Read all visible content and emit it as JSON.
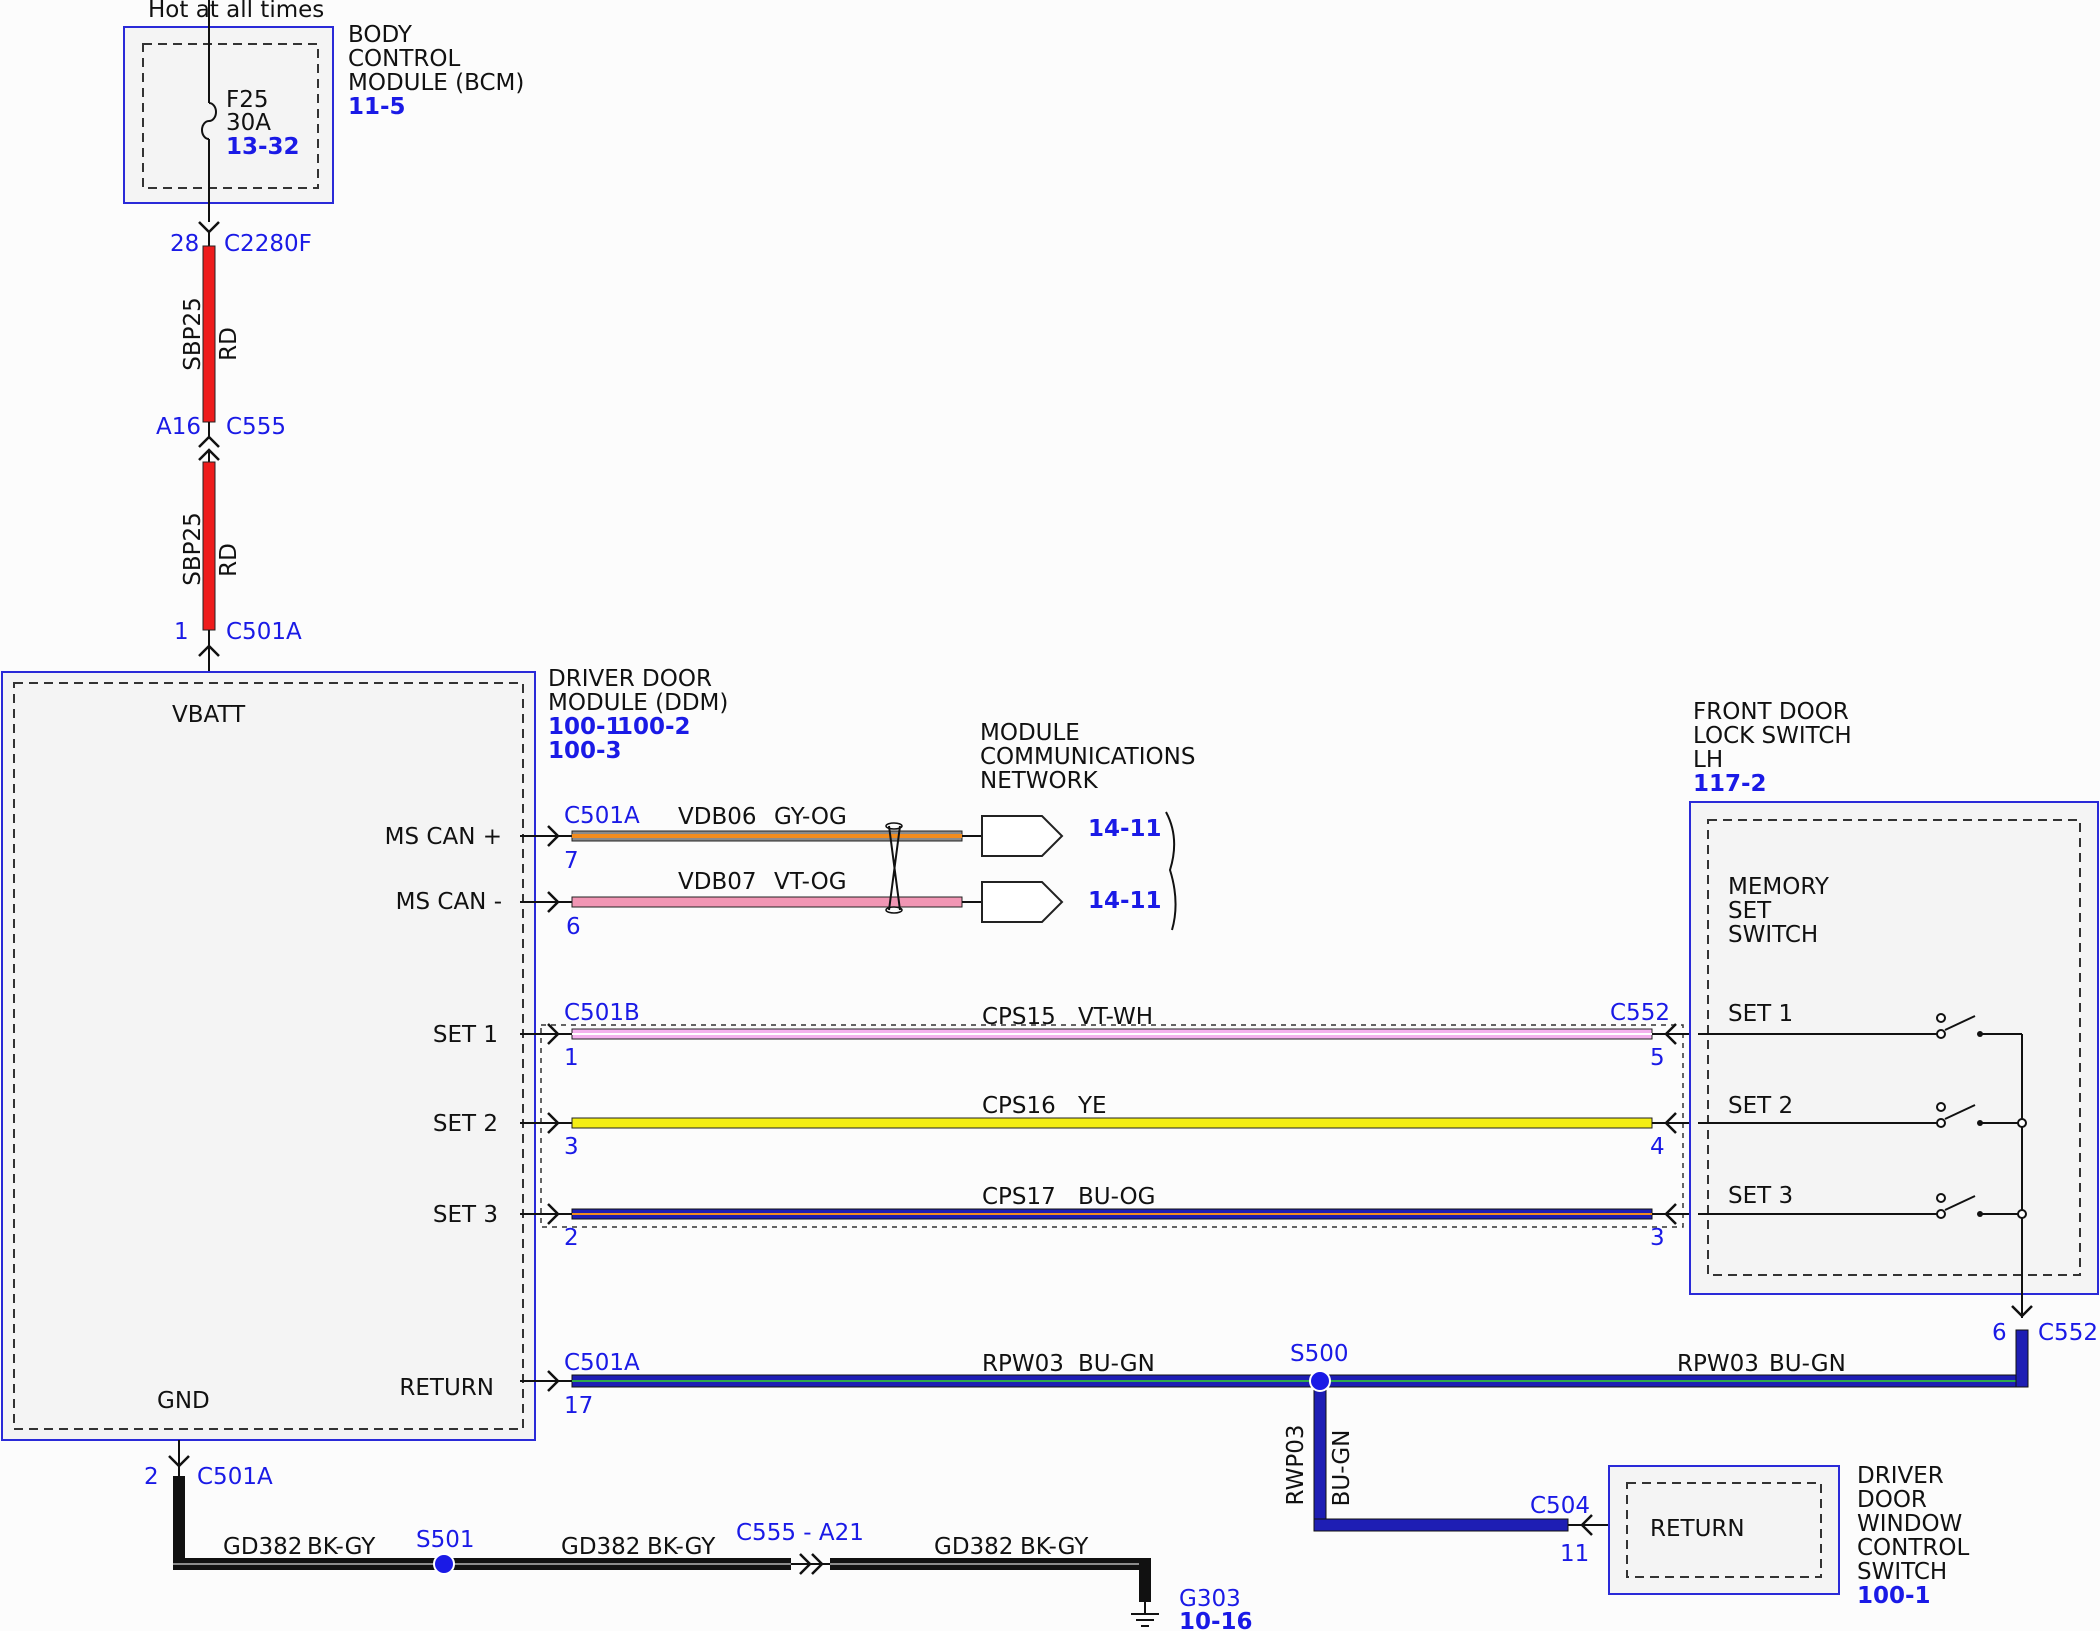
{
  "bcm": {
    "power_note": "Hot at all times",
    "title_lines": [
      "BODY",
      "CONTROL",
      "MODULE (BCM)"
    ],
    "ref": "11-5",
    "fuse_id": "F25",
    "fuse_rating": "30A",
    "fuse_ref": "13-32"
  },
  "feed_wire": {
    "top_pin": "28",
    "top_connector": "C2280F",
    "circuit": "SBP25",
    "color": "RD",
    "mid_pin": "A16",
    "mid_connector": "C555",
    "bottom_pin": "1",
    "bottom_connector": "C501A"
  },
  "ddm": {
    "title_lines": [
      "DRIVER DOOR",
      "MODULE (DDM)"
    ],
    "refs": [
      "100-1",
      "100-2",
      "100-3"
    ],
    "vbatt_label": "VBATT",
    "gnd_label": "GND",
    "pins": {
      "ms_can_plus": "MS CAN +",
      "ms_can_minus": "MS CAN -",
      "set1": "SET 1",
      "set2": "SET 2",
      "set3": "SET 3",
      "return": "RETURN"
    }
  },
  "network": {
    "title_lines": [
      "MODULE",
      "COMMUNICATIONS",
      "NETWORK"
    ],
    "can_plus": {
      "connector": "C501A",
      "pin": "7",
      "circuit": "VDB06",
      "color": "GY-OG",
      "ref": "14-11"
    },
    "can_minus": {
      "pin": "6",
      "circuit": "VDB07",
      "color": "VT-OG",
      "ref": "14-11"
    }
  },
  "set_wires": {
    "left_connector": "C501B",
    "right_connector": "C552",
    "set1": {
      "left_pin": "1",
      "right_pin": "5",
      "circuit": "CPS15",
      "color": "VT-WH"
    },
    "set2": {
      "left_pin": "3",
      "right_pin": "4",
      "circuit": "CPS16",
      "color": "YE"
    },
    "set3": {
      "left_pin": "2",
      "right_pin": "3",
      "circuit": "CPS17",
      "color": "BU-OG"
    }
  },
  "lock_switch": {
    "title_lines": [
      "FRONT DOOR",
      "LOCK SWITCH",
      "LH"
    ],
    "ref": "117-2",
    "inner_lines": [
      "MEMORY",
      "SET",
      "SWITCH"
    ],
    "set1": "SET 1",
    "set2": "SET 2",
    "set3": "SET 3",
    "out_pin": "6",
    "out_connector": "C552"
  },
  "return_wire": {
    "connector": "C501A",
    "pin": "17",
    "circuit_left": "RPW03",
    "color_left": "BU-GN",
    "splice": "S500",
    "circuit_right": "RPW03",
    "color_right": "BU-GN",
    "branch_circuit": "RWP03",
    "branch_color": "BU-GN",
    "window_connector": "C504",
    "window_pin": "11"
  },
  "window_switch": {
    "inner_label": "RETURN",
    "title_lines": [
      "DRIVER",
      "DOOR",
      "WINDOW",
      "CONTROL",
      "SWITCH"
    ],
    "ref": "100-1"
  },
  "ground": {
    "pin": "2",
    "connector": "C501A",
    "seg1_circuit": "GD382",
    "seg1_color": "BK-GY",
    "splice": "S501",
    "seg2_circuit": "GD382",
    "seg2_color": "BK-GY",
    "inline_connector": "C555 - A21",
    "seg3_circuit": "GD382",
    "seg3_color": "BK-GY",
    "ground_id": "G303",
    "ground_ref": "10-16"
  }
}
